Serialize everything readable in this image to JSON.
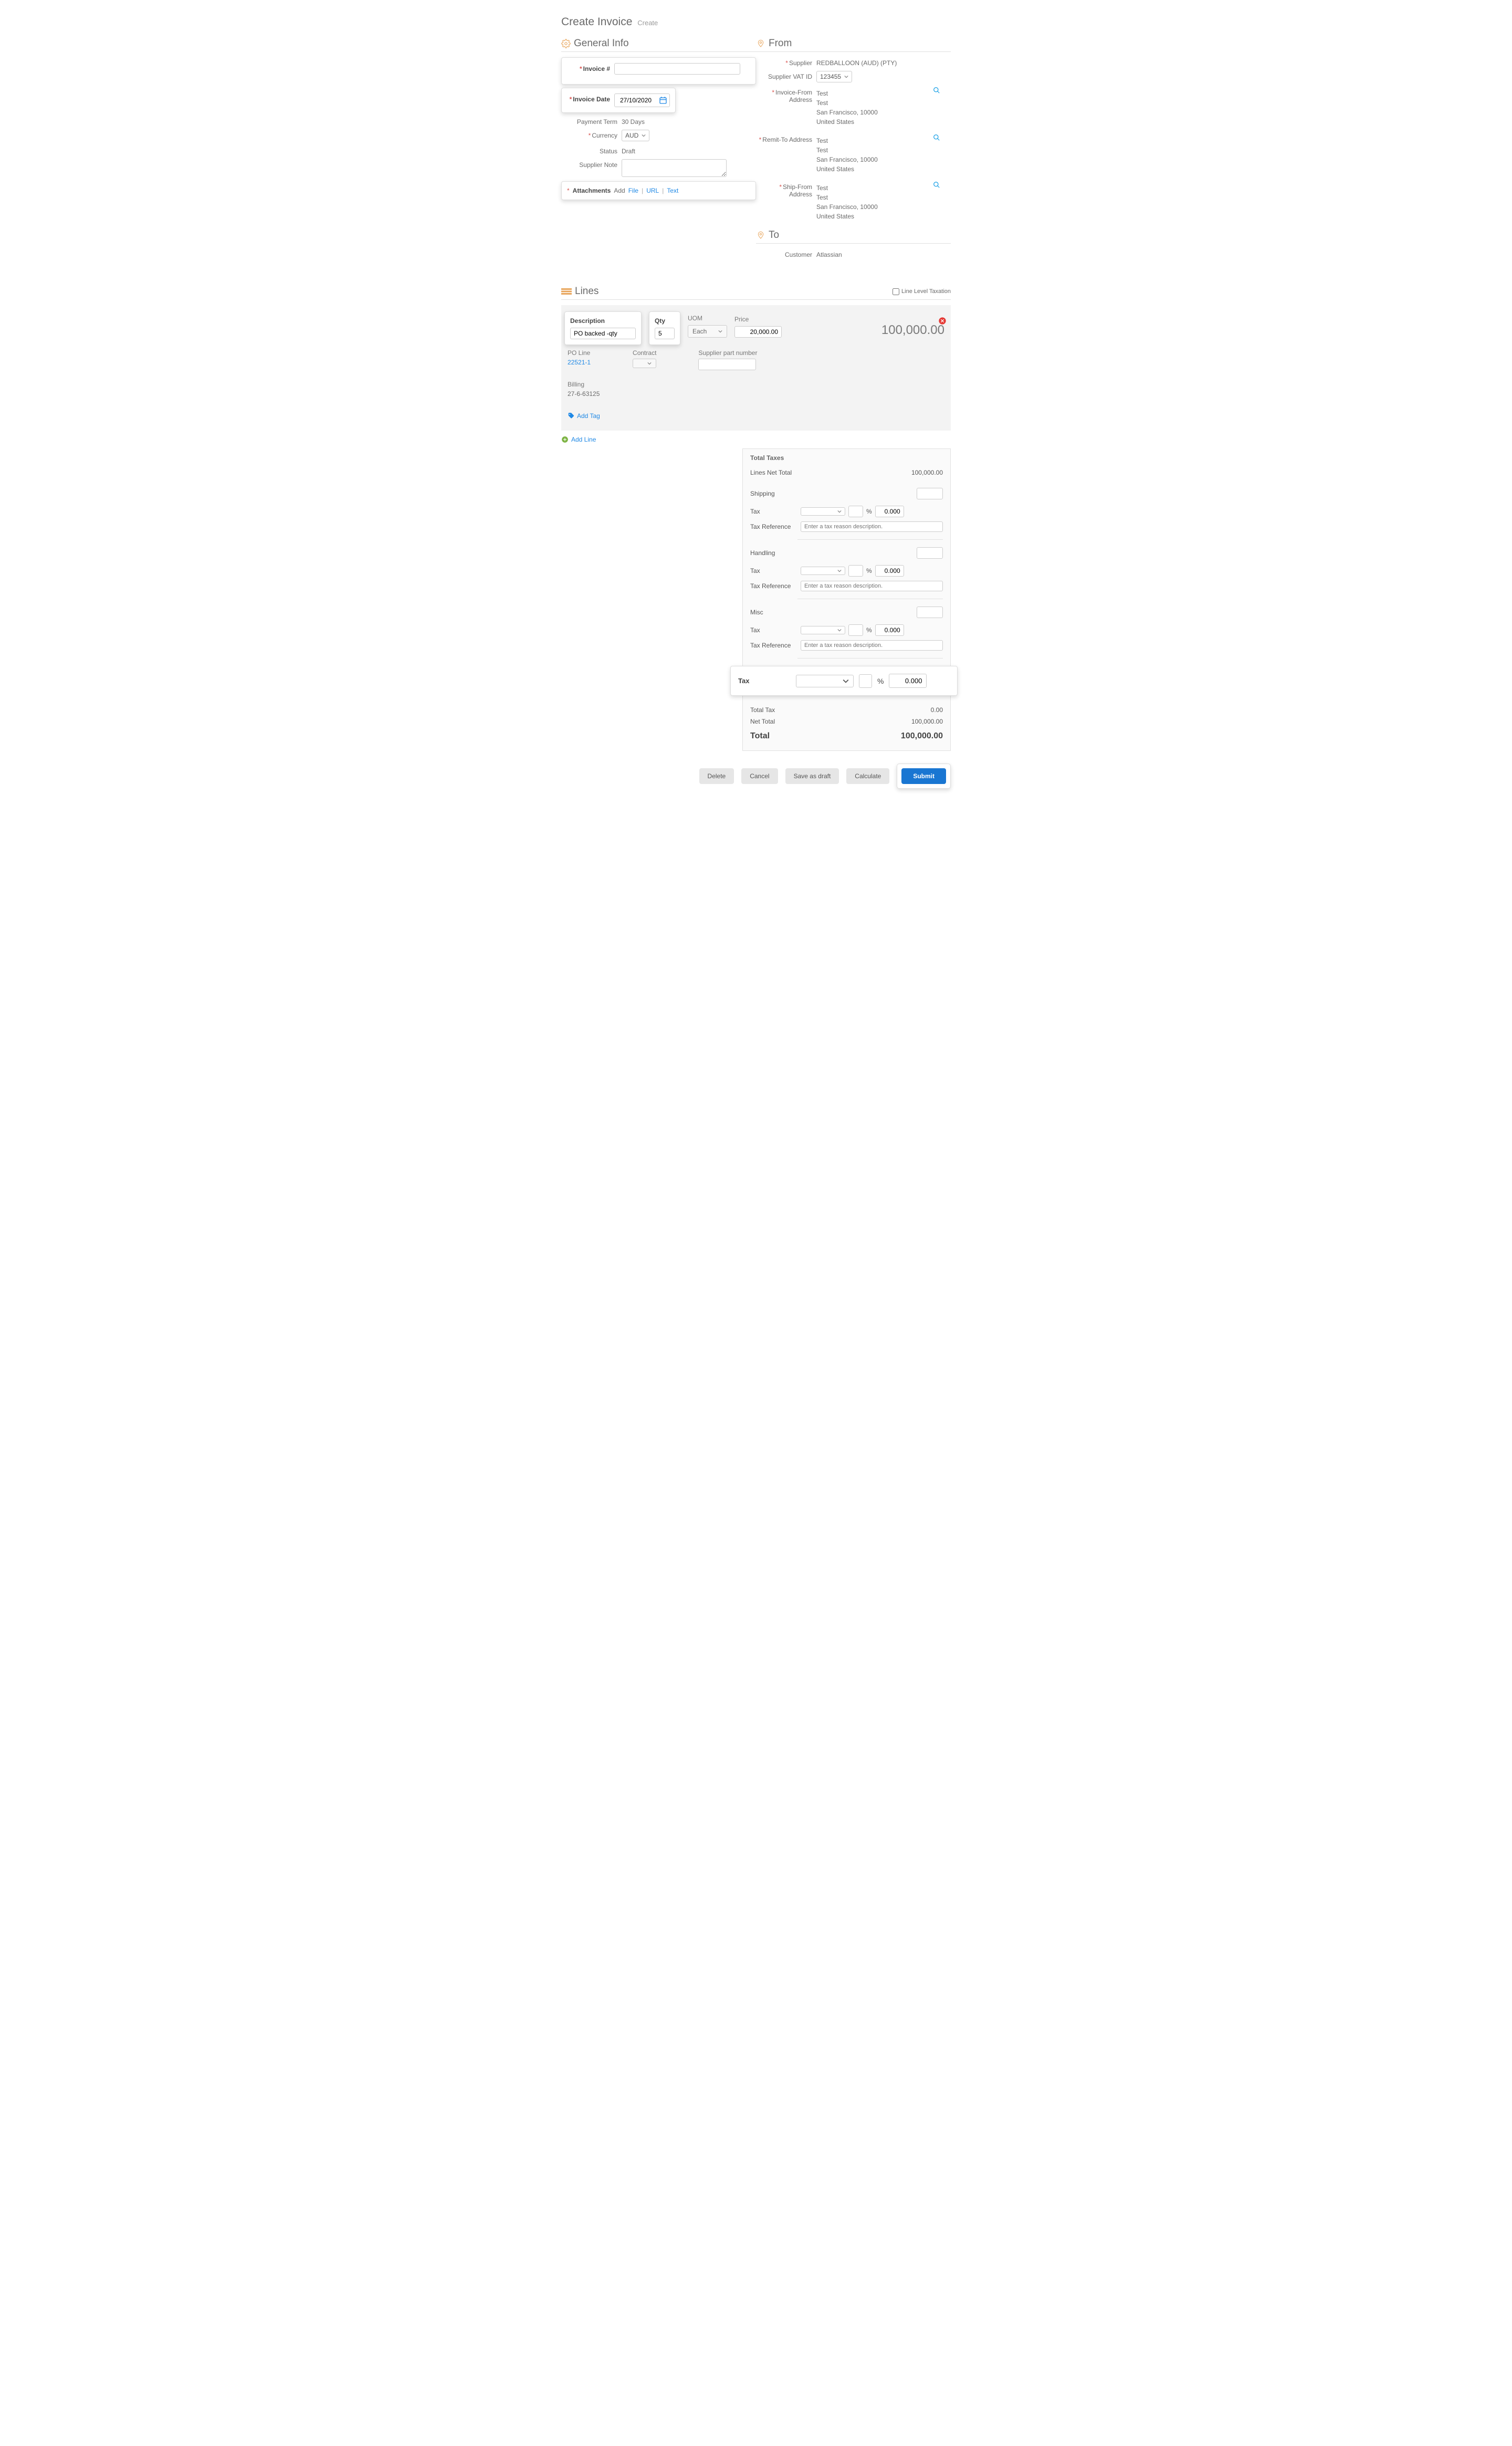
{
  "page": {
    "title": "Create Invoice",
    "subtitle": "Create"
  },
  "general": {
    "heading": "General Info",
    "invoice_num_label": "Invoice #",
    "invoice_num_value": "",
    "invoice_date_label": "Invoice Date",
    "invoice_date_value": "27/10/2020",
    "payment_term_label": "Payment Term",
    "payment_term_value": "30 Days",
    "currency_label": "Currency",
    "currency_value": "AUD",
    "status_label": "Status",
    "status_value": "Draft",
    "supplier_note_label": "Supplier Note",
    "supplier_note_value": "",
    "attachments_label": "Attachments",
    "attachments_add": "Add",
    "attachments_file": "File",
    "attachments_url": "URL",
    "attachments_text": "Text"
  },
  "from": {
    "heading": "From",
    "supplier_label": "Supplier",
    "supplier_value": "REDBALLOON (AUD) (PTY)",
    "vat_label": "Supplier VAT ID",
    "vat_value": "123455",
    "inv_from_label": "Invoice-From Address",
    "remit_label": "Remit-To Address",
    "ship_label": "Ship-From Address",
    "addr_line1": "Test",
    "addr_line2": "Test",
    "addr_line3": "San Francisco, 10000",
    "addr_line4": "United States"
  },
  "to": {
    "heading": "To",
    "customer_label": "Customer",
    "customer_value": "Atlassian"
  },
  "lines": {
    "heading": "Lines",
    "line_level_tax": "Line Level Taxation",
    "desc_label": "Description",
    "desc_value": "PO backed -qty",
    "qty_label": "Qty",
    "qty_value": "5",
    "uom_label": "UOM",
    "uom_value": "Each",
    "price_label": "Price",
    "price_value": "20,000.00",
    "total_value": "100,000.00",
    "po_line_label": "PO Line",
    "po_line_value": "22521-1",
    "contract_label": "Contract",
    "part_label": "Supplier part number",
    "part_value": "",
    "billing_label": "Billing",
    "billing_value": "27-6-63125",
    "add_tag": "Add Tag",
    "add_line": "Add Line"
  },
  "totals": {
    "title": "Total Taxes",
    "lines_net_label": "Lines Net Total",
    "lines_net_value": "100,000.00",
    "shipping_label": "Shipping",
    "handling_label": "Handling",
    "misc_label": "Misc",
    "tax_label": "Tax",
    "tax_ref_label": "Tax Reference",
    "tax_ref_placeholder": "Enter a tax reason description.",
    "tax_amount": "0.000",
    "big_tax_label": "Tax",
    "big_tax_amount": "0.000",
    "total_tax_label": "Total Tax",
    "total_tax_value": "0.00",
    "net_total_label": "Net Total",
    "net_total_value": "100,000.00",
    "grand_label": "Total",
    "grand_value": "100,000.00"
  },
  "actions": {
    "delete": "Delete",
    "cancel": "Cancel",
    "save_draft": "Save as draft",
    "calculate": "Calculate",
    "submit": "Submit"
  }
}
